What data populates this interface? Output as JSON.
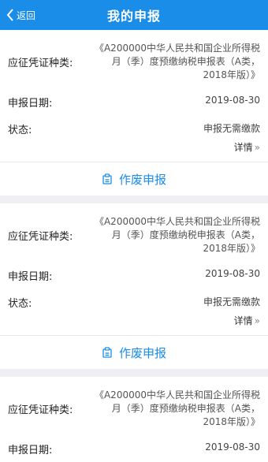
{
  "header": {
    "back_label": "返回",
    "title": "我的申报"
  },
  "labels": {
    "voucher_type": "应征凭证种类:",
    "date": "申报日期:",
    "status": "状态:",
    "detail": "详情",
    "chevron": "»",
    "action": "作废申报"
  },
  "records": [
    {
      "voucher_type": "《A200000中华人民共和国企业所得税月（季）度预缴纳税申报表（A类，2018年版）》",
      "date": "2019-08-30",
      "status": "申报无需缴款"
    },
    {
      "voucher_type": "《A200000中华人民共和国企业所得税月（季）度预缴纳税申报表（A类，2018年版）》",
      "date": "2019-08-30",
      "status": "申报无需缴款"
    },
    {
      "voucher_type": "《A200000中华人民共和国企业所得税月（季）度预缴纳税申报表（A类，2018年版）》",
      "date": "2019-08-30",
      "status": ""
    }
  ],
  "colors": {
    "accent": "#1a8de8",
    "background": "#efeff4"
  }
}
